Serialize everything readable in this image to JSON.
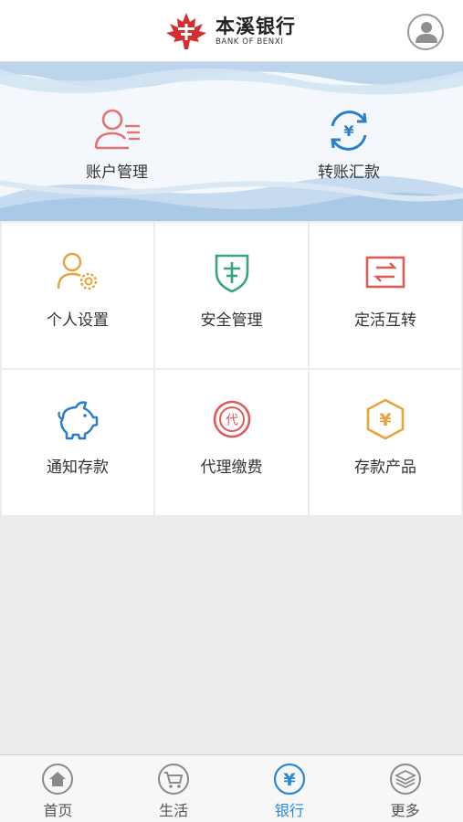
{
  "header": {
    "bank_name_cn": "本溪银行",
    "bank_name_en": "BANK OF BENXI",
    "logo_icon": "maple-leaf-logo",
    "user_icon": "user-avatar-icon"
  },
  "banner": {
    "items": [
      {
        "label": "账户管理",
        "icon": "account-user-icon",
        "color": "#e57373"
      },
      {
        "label": "转账汇款",
        "icon": "transfer-yuan-icon",
        "color": "#2a7fc9"
      }
    ]
  },
  "menu": {
    "items": [
      {
        "label": "个人设置",
        "icon": "user-gear-icon",
        "color": "#e8a33c"
      },
      {
        "label": "安全管理",
        "icon": "shield-icon",
        "color": "#3aa57a"
      },
      {
        "label": "定活互转",
        "icon": "exchange-icon",
        "color": "#e05a5a"
      },
      {
        "label": "通知存款",
        "icon": "piggy-bank-icon",
        "color": "#2a7fc9"
      },
      {
        "label": "代理缴费",
        "icon": "agent-pay-icon",
        "color": "#e05a5a"
      },
      {
        "label": "存款产品",
        "icon": "hexagon-yuan-icon",
        "color": "#e8a33c"
      }
    ]
  },
  "tabbar": {
    "active_color": "#2a8ad6",
    "tabs": [
      {
        "label": "首页",
        "icon": "home-icon",
        "active": false
      },
      {
        "label": "生活",
        "icon": "cart-icon",
        "active": false
      },
      {
        "label": "银行",
        "icon": "yuan-icon",
        "active": true
      },
      {
        "label": "更多",
        "icon": "layers-icon",
        "active": false
      }
    ]
  }
}
